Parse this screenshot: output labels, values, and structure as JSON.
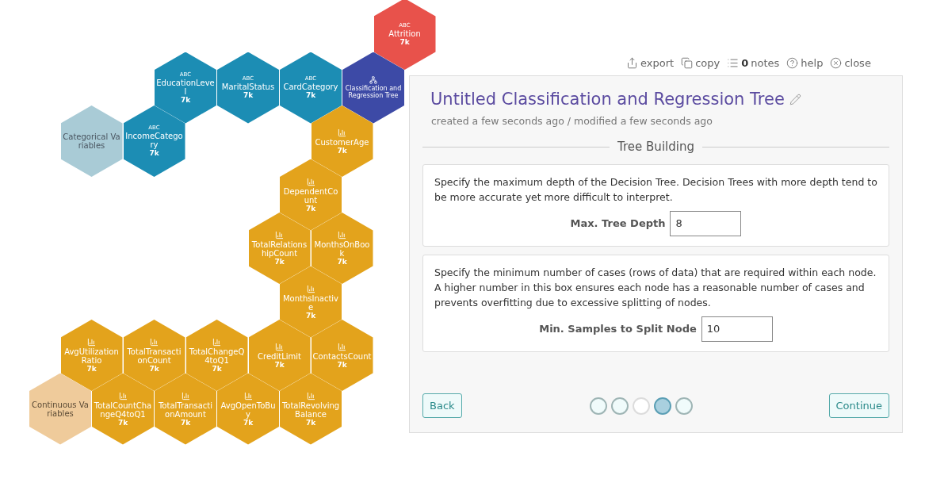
{
  "canvas": {
    "hexes": [
      {
        "kind": "target",
        "badge": "ABC",
        "label": "Attrition",
        "count": "7k"
      },
      {
        "kind": "categorical",
        "badge": "ABC",
        "label": "EducationLevel",
        "count": "7k"
      },
      {
        "kind": "categorical",
        "badge": "ABC",
        "label": "MaritalStatus",
        "count": "7k"
      },
      {
        "kind": "categorical",
        "badge": "ABC",
        "label": "CardCategory",
        "count": "7k"
      },
      {
        "kind": "model",
        "label": "Classification and Regression Tree"
      },
      {
        "kind": "group-categorical",
        "label": "Categorical Variables"
      },
      {
        "kind": "categorical",
        "badge": "ABC",
        "label": "IncomeCategory",
        "count": "7k"
      },
      {
        "kind": "continuous",
        "label": "CustomerAge",
        "count": "7k"
      },
      {
        "kind": "continuous",
        "label": "DependentCount",
        "count": "7k"
      },
      {
        "kind": "continuous",
        "label": "TotalRelationshipCount",
        "count": "7k"
      },
      {
        "kind": "continuous",
        "label": "MonthsOnBook",
        "count": "7k"
      },
      {
        "kind": "continuous",
        "label": "MonthsInactive",
        "count": "7k"
      },
      {
        "kind": "continuous",
        "label": "AvgUtilizationRatio",
        "count": "7k"
      },
      {
        "kind": "continuous",
        "label": "TotalTransactionCount",
        "count": "7k"
      },
      {
        "kind": "continuous",
        "label": "TotalChangeQ4toQ1",
        "count": "7k"
      },
      {
        "kind": "continuous",
        "label": "CreditLimit",
        "count": "7k"
      },
      {
        "kind": "continuous",
        "label": "ContactsCount",
        "count": "7k"
      },
      {
        "kind": "group-continuous",
        "label": "Continuous Variables"
      },
      {
        "kind": "continuous",
        "label": "TotalCountChangeQ4toQ1",
        "count": "7k"
      },
      {
        "kind": "continuous",
        "label": "TotalTransactionAmount",
        "count": "7k"
      },
      {
        "kind": "continuous",
        "label": "AvgOpenToBuy",
        "count": "7k"
      },
      {
        "kind": "continuous",
        "label": "TotalRevolvingBalance",
        "count": "7k"
      }
    ]
  },
  "toolbar": [
    {
      "kind": "export",
      "label": "export"
    },
    {
      "kind": "copy",
      "label": "copy"
    },
    {
      "kind": "notes",
      "count": "0",
      "label": "notes"
    },
    {
      "kind": "help",
      "label": "help"
    },
    {
      "kind": "close",
      "label": "close"
    }
  ],
  "panel": {
    "title": "Untitled Classification and Regression Tree",
    "subtitle": "created a few seconds ago / modified a few seconds ago",
    "section": "Tree Building",
    "settings": [
      {
        "description": "Specify the maximum depth of the Decision Tree. Decision Trees with more depth tend to be more accurate yet more difficult to interpret.",
        "label": "Max. Tree Depth",
        "value": "8"
      },
      {
        "description": "Specify the minimum number of cases (rows of data) that are required within each node. A higher number in this box ensures each node has a reasonable number of cases and prevents overfitting due to excessive splitting of nodes.",
        "label": "Min. Samples to Split Node",
        "value": "10"
      }
    ],
    "back": "Back",
    "continue": "Continue",
    "steps": [
      {
        "selected": false,
        "disabled": false
      },
      {
        "selected": false,
        "disabled": false
      },
      {
        "selected": false,
        "disabled": true
      },
      {
        "selected": true,
        "disabled": false
      },
      {
        "selected": false,
        "disabled": false
      }
    ]
  }
}
